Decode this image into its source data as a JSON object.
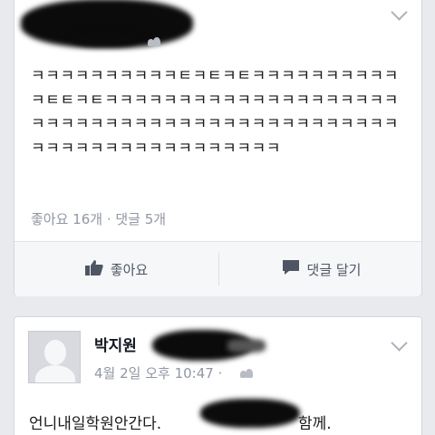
{
  "post1": {
    "text": "ㅋㅋㅋㅋㅋㅋㅋㅋㅋㅋㅌㅋㅌㅋㅌㅋㅋㅋㅋㅋㅋㅋㅋㅋㅋㅋㅌㅌㅋㅌㅋㅋㅋㅋㅋㅋㅋㅋㅋㅋㅋㅋㅋㅋㅋㅋㅋㅋㅋㅋㅋㅋㅋㅋㅋㅋㅋㅋㅋㅋㅋㅋㅋㅋㅋㅋㅋㅋㅋㅋㅋㅋㅋㅋㅋㅋㅋㅋㅋㅋㅋㅋㅋㅋㅋㅋㅋㅋㅋㅋㅋㅋ",
    "counts": "좋아요 16개 · 댓글 5개",
    "like_label": "좋아요",
    "comment_label": "댓글 달기"
  },
  "post2": {
    "author": "박지원",
    "timestamp": "4월 2일 오후 10:47 ·",
    "text": "언니내일학원안간다.",
    "text_suffix": "함께."
  },
  "icons": {
    "options": "chevron-down-icon",
    "audience": "friends-icon",
    "like": "thumbs-up-icon",
    "comment": "comment-icon",
    "avatar": "default-avatar-icon"
  },
  "colors": {
    "background": "#e9eaed",
    "card": "#ffffff",
    "meta_text": "#9197a3",
    "action_text": "#4e5665",
    "action_bar": "#f6f7f9"
  }
}
